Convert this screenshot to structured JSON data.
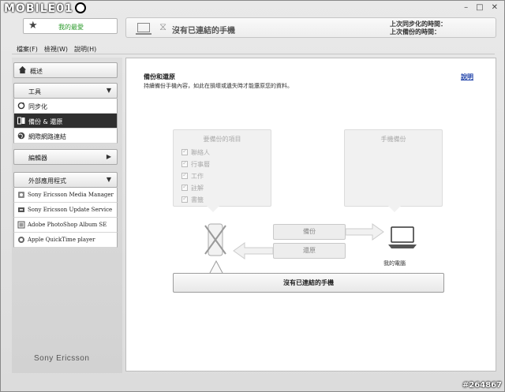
{
  "watermark": "MOBILE01",
  "window_controls": [
    "–",
    "□",
    "✕"
  ],
  "header": {
    "favorites_label": "我的最愛",
    "status_title": "沒有已連結的手機",
    "last_sync_label": "上次同步化的時間：",
    "last_backup_label": "上次備份的時間："
  },
  "menu": [
    "檔案(F)",
    "檢視(W)",
    "說明(H)"
  ],
  "sidebar": {
    "overview": "概述",
    "tools_header": "工具",
    "tools_items": [
      "同步化",
      "備份 & 還原",
      "網際網路連結"
    ],
    "editor_header": "編輯器",
    "apps_header": "外部應用程式",
    "apps_items": [
      "Sony Ericsson Media Manager",
      "Sony Ericsson Update Service",
      "Adobe PhotoShop Album SE",
      "Apple QuickTime player"
    ],
    "brand": "Sony Ericsson"
  },
  "main": {
    "heading": "備份和還原",
    "description": "持續備份手機內容，如此在損壞或遺失時才能還原您的資料。",
    "help": "說明",
    "items_title": "要備份的項目",
    "items": [
      "聯絡人",
      "行事曆",
      "工作",
      "註解",
      "書籤"
    ],
    "phone_backup_title": "手機備份",
    "backup_button": "備份",
    "restore_button": "還原",
    "pc_label": "我的電腦",
    "no_phone": "沒有已連結的手機"
  },
  "post_id": "#264867"
}
